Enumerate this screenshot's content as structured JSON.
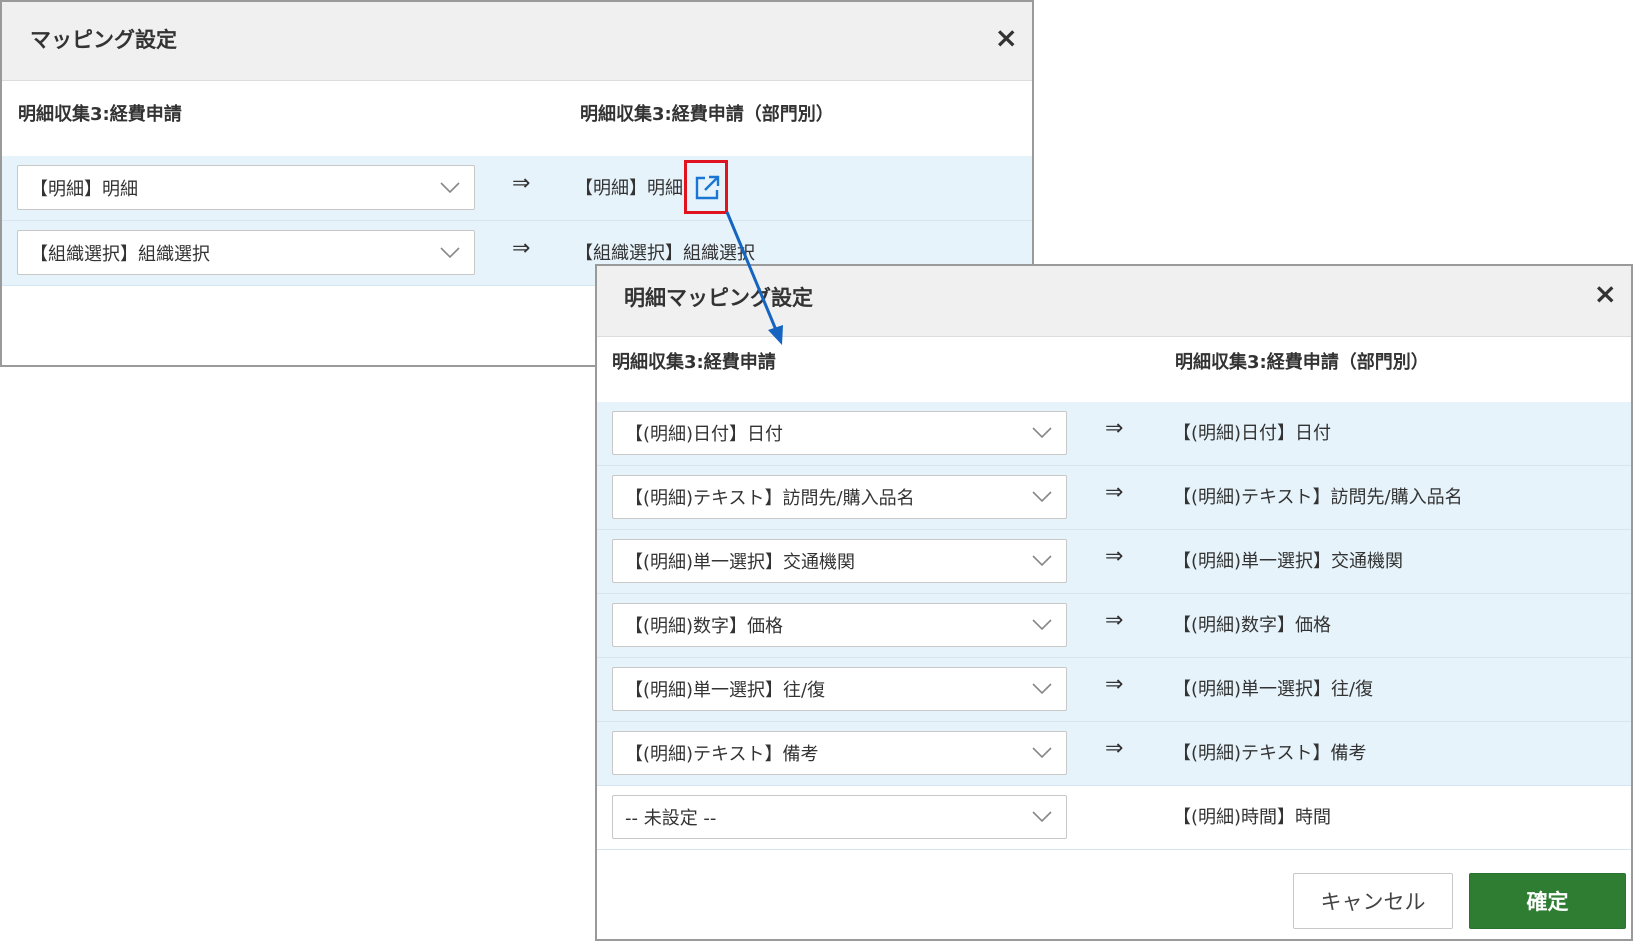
{
  "dialog1": {
    "title": "マッピング設定",
    "close": "×",
    "source_header": "明細収集3:経費申請",
    "target_header": "明細収集3:経費申請（部門別）",
    "arrow": "⇒",
    "rows": [
      {
        "source": "【明細】明細",
        "target": "【明細】明細",
        "has_link": true
      },
      {
        "source": "【組織選択】組織選択",
        "target": "【組織選択】組織選択",
        "has_link": false
      }
    ]
  },
  "dialog2": {
    "title": "明細マッピング設定",
    "close": "×",
    "source_header": "明細収集3:経費申請",
    "target_header": "明細収集3:経費申請（部門別）",
    "arrow": "⇒",
    "rows": [
      {
        "source": "【(明細)日付】日付",
        "target": "【(明細)日付】日付",
        "mapped": true
      },
      {
        "source": "【(明細)テキスト】訪問先/購入品名",
        "target": "【(明細)テキスト】訪問先/購入品名",
        "mapped": true
      },
      {
        "source": "【(明細)単一選択】交通機関",
        "target": "【(明細)単一選択】交通機関",
        "mapped": true
      },
      {
        "source": "【(明細)数字】価格",
        "target": "【(明細)数字】価格",
        "mapped": true
      },
      {
        "source": "【(明細)単一選択】往/復",
        "target": "【(明細)単一選択】往/復",
        "mapped": true
      },
      {
        "source": "【(明細)テキスト】備考",
        "target": "【(明細)テキスト】備考",
        "mapped": true
      },
      {
        "source": "-- 未設定 --",
        "target": "【(明細)時間】時間",
        "mapped": false
      }
    ],
    "cancel_label": "キャンセル",
    "confirm_label": "確定"
  },
  "colors": {
    "row_highlight": "#e6f3fa",
    "confirm_button": "#2e7d32",
    "callout_box": "#e0141e",
    "callout_arrow": "#1565c0",
    "link_icon": "#1976d2"
  }
}
